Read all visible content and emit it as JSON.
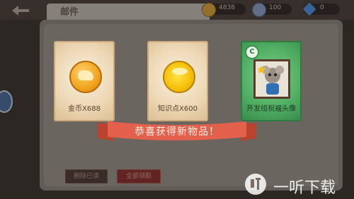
{
  "header": {
    "title": "邮件",
    "resources": [
      {
        "icon": "gold-coin-icon",
        "value": "4838"
      },
      {
        "icon": "silver-coin-icon",
        "value": "100"
      },
      {
        "icon": "diamond-icon",
        "value": "0"
      }
    ]
  },
  "mail": {
    "delete_read_label": "删除已读",
    "claim_all_label": "全部领取"
  },
  "reward_popup": {
    "items": [
      {
        "label": "金币X688",
        "icon": "gold-coin-icon"
      },
      {
        "label": "知识点X600",
        "icon": "knowledge-point-icon"
      },
      {
        "label": "开发组祝福头像",
        "icon": "avatar-portrait-icon",
        "badge": "C"
      }
    ],
    "banner_text": "恭喜获得新物品！"
  },
  "watermark": {
    "logo": "听",
    "text": "一听下载"
  },
  "colors": {
    "ribbon": "#e2604c",
    "card_tan": "#eed9b8",
    "card_green": "#4fae62"
  }
}
